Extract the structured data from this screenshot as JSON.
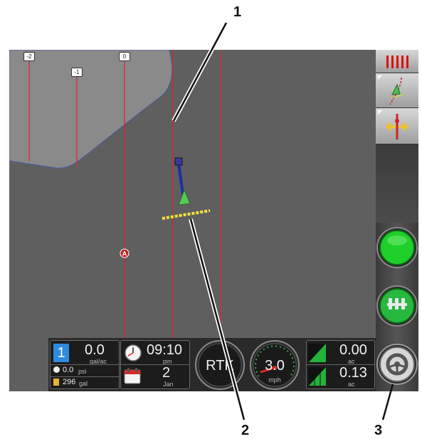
{
  "callouts": {
    "c1": "1",
    "c2": "2",
    "c3": "3"
  },
  "map": {
    "line_labels": [
      "-2",
      "-1",
      "0"
    ],
    "marker_a": "A",
    "colors": {
      "background": "#5f5f5f",
      "boundary": "#8a8a8a",
      "guidance_line": "#d22a2a",
      "swath_bar": "#f5e33a"
    }
  },
  "sidebar": {
    "buttons": [
      {
        "icon": "implement-sections-icon"
      },
      {
        "icon": "guidance-mode-icon"
      },
      {
        "icon": "nudge-shift-icon"
      }
    ],
    "master_button_icon": "master-switch-green-icon",
    "sections_button_icon": "section-control-icon",
    "steering_button_icon": "auto-steer-wheel-icon"
  },
  "status": {
    "rate": {
      "section": "1",
      "value": "0.0",
      "unit": "gal/ac"
    },
    "pressure": {
      "value": "0.0",
      "unit": "psi"
    },
    "tank": {
      "value": "296",
      "unit": "gal"
    },
    "time": {
      "value": "09:10",
      "ampm": "pm"
    },
    "date": {
      "day": "2",
      "month": "Jan"
    },
    "rtk_label": "RTK",
    "speed": {
      "value": "3.0",
      "unit": "mph"
    },
    "area1": {
      "value": "0.00",
      "unit": "ac"
    },
    "area2": {
      "value": "0.13",
      "unit": "ac"
    }
  }
}
